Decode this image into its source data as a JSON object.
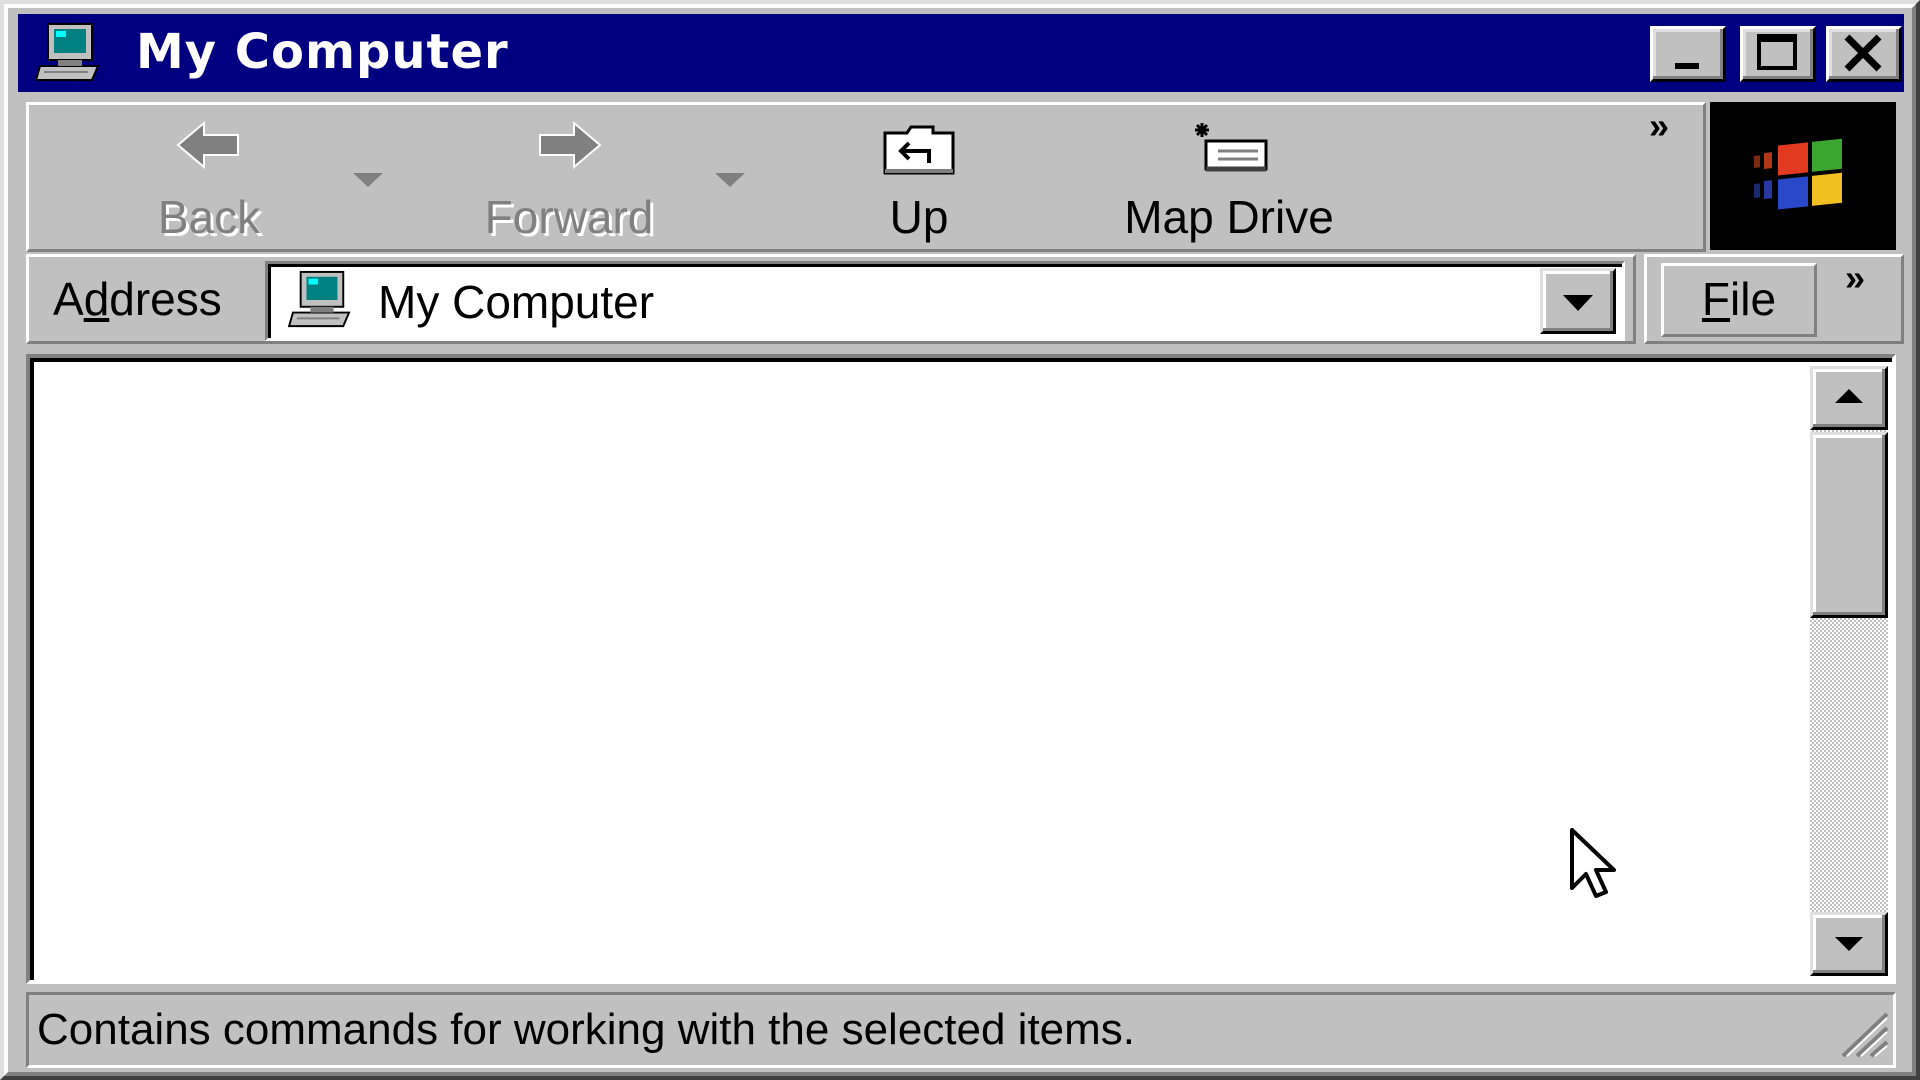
{
  "window": {
    "title": "My Computer",
    "icon": "my-computer-icon"
  },
  "title_buttons": {
    "minimize": "minimize-icon",
    "maximize": "maximize-icon",
    "close": "close-icon"
  },
  "toolbar": {
    "back_label": "Back",
    "forward_label": "Forward",
    "up_label": "Up",
    "map_drive_label": "Map Drive",
    "back_enabled": false,
    "forward_enabled": false
  },
  "address": {
    "label_prefix": "A",
    "label_underlined": "d",
    "label_suffix": "dress",
    "value": "My Computer"
  },
  "menu": {
    "file_underlined": "F",
    "file_rest": "ile"
  },
  "statusbar": {
    "text": "Contains commands for working with the selected items."
  },
  "colors": {
    "titlebar": "#000080",
    "face": "#c0c0c0",
    "content_bg": "#ffffff"
  }
}
